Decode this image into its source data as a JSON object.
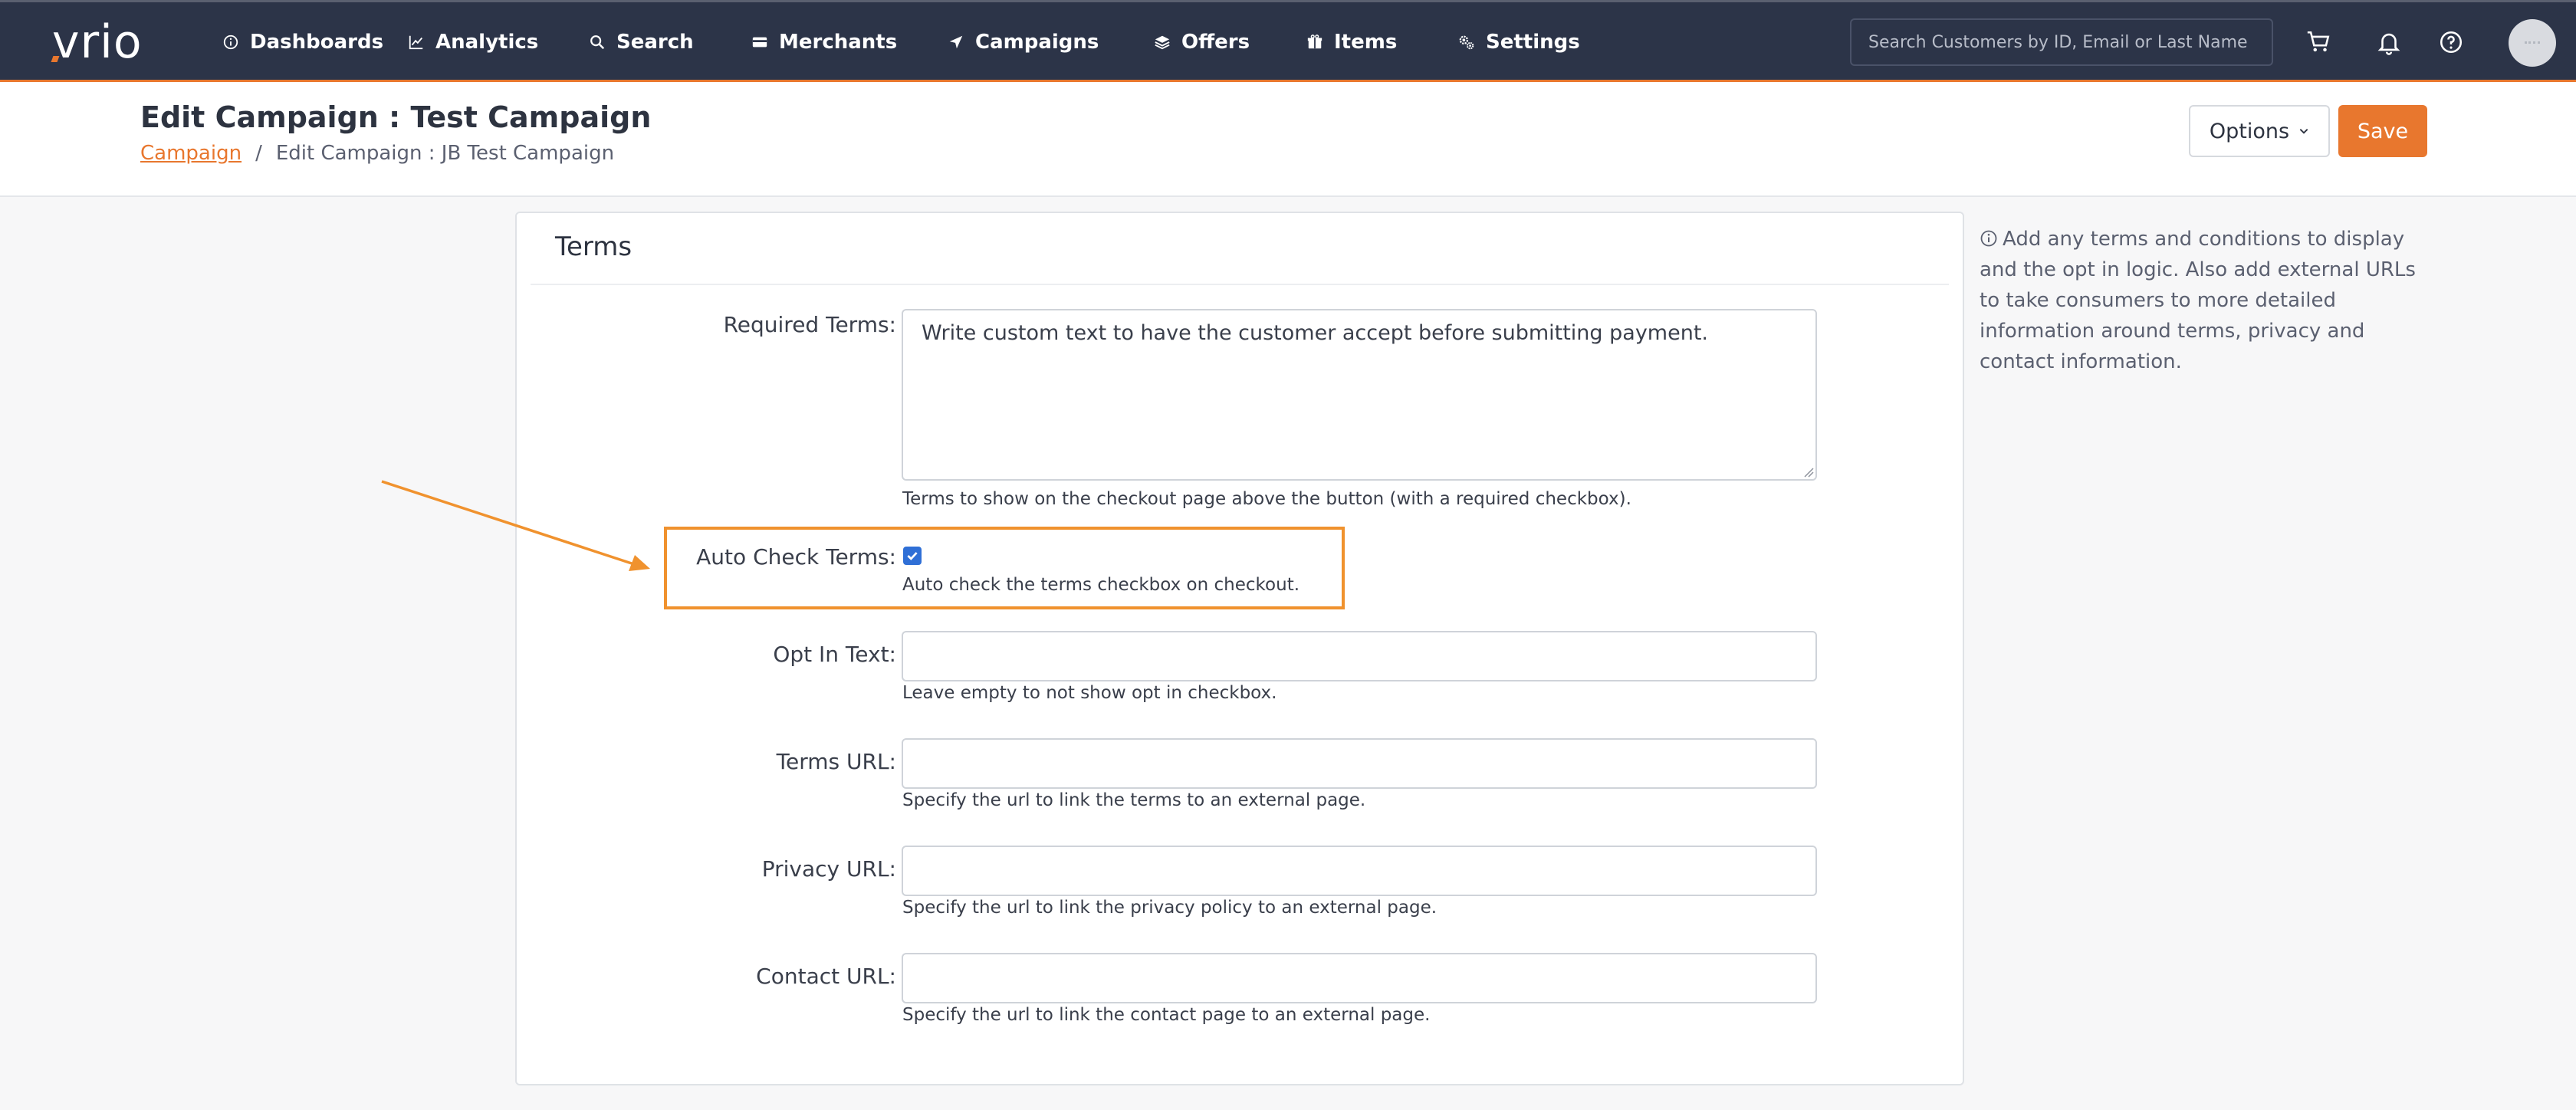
{
  "app": {
    "logo": "vrio"
  },
  "nav": {
    "items": [
      {
        "label": "Dashboards",
        "icon": "info-circle-icon"
      },
      {
        "label": "Analytics",
        "icon": "line-chart-icon"
      },
      {
        "label": "Search",
        "icon": "search-icon"
      },
      {
        "label": "Merchants",
        "icon": "credit-card-icon"
      },
      {
        "label": "Campaigns",
        "icon": "paper-plane-icon",
        "active": true
      },
      {
        "label": "Offers",
        "icon": "layers-icon"
      },
      {
        "label": "Items",
        "icon": "gift-box-icon"
      },
      {
        "label": "Settings",
        "icon": "gears-icon"
      }
    ],
    "search_placeholder": "Search Customers by ID, Email or Last Name",
    "accent_color": "#e8772e",
    "bar_color": "#2c3448"
  },
  "header": {
    "title": "Edit Campaign : Test Campaign",
    "breadcrumb": {
      "link": "Campaign",
      "separator": "/",
      "current": "Edit Campaign : JB Test Campaign"
    },
    "options_label": "Options",
    "save_label": "Save"
  },
  "terms": {
    "section_title": "Terms",
    "required_terms": {
      "label": "Required Terms:",
      "value": "Write custom text to have the customer accept before submitting payment.",
      "help": "Terms to show on the checkout page above the button (with a required checkbox)."
    },
    "auto_check": {
      "label": "Auto Check Terms:",
      "checked": true,
      "help": "Auto check the terms checkbox on checkout."
    },
    "opt_in": {
      "label": "Opt In Text:",
      "value": "",
      "help": "Leave empty to not show opt in checkbox."
    },
    "terms_url": {
      "label": "Terms URL:",
      "value": "",
      "help": "Specify the url to link the terms to an external page."
    },
    "privacy_url": {
      "label": "Privacy URL:",
      "value": "",
      "help": "Specify the url to link the privacy policy to an external page."
    },
    "contact_url": {
      "label": "Contact URL:",
      "value": "",
      "help": "Specify the url to link the contact page to an external page."
    }
  },
  "side_info": {
    "text": "Add any terms and conditions to display and the opt in logic. Also add external URLs to take consumers to more detailed information around terms, privacy and contact information."
  }
}
